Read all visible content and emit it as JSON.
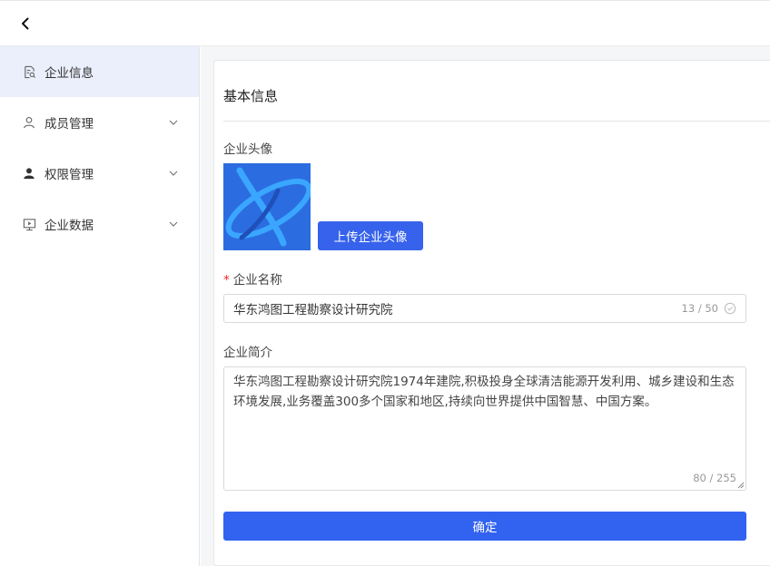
{
  "header": {
    "back_icon": "chevron-left-icon"
  },
  "sidebar": {
    "items": [
      {
        "label": "企业信息",
        "icon": "document-search-icon",
        "active": true,
        "expandable": false
      },
      {
        "label": "成员管理",
        "icon": "user-outline-icon",
        "active": false,
        "expandable": true
      },
      {
        "label": "权限管理",
        "icon": "user-filled-icon",
        "active": false,
        "expandable": true
      },
      {
        "label": "企业数据",
        "icon": "monitor-icon",
        "active": false,
        "expandable": true
      }
    ]
  },
  "form": {
    "section_title": "基本信息",
    "avatar_label": "企业头像",
    "upload_button": "上传企业头像",
    "name_required_mark": "*",
    "name_label": "企业名称",
    "name_value": "华东鸿图工程勘察设计研究院",
    "name_counter": "13 / 50",
    "intro_label": "企业简介",
    "intro_value": "华东鸿图工程勘察设计研究院1974年建院,积极投身全球清洁能源开发利用、城乡建设和生态环境发展,业务覆盖300多个国家和地区,持续向世界提供中国智慧、中国方案。",
    "intro_counter": "80 / 255",
    "confirm_button": "确定"
  },
  "colors": {
    "primary": "#3262f0",
    "avatar_bg": "#2b6de0",
    "avatar_accent": "#3aa6ff",
    "active_nav_bg": "#ebeefb",
    "required": "#f5222d"
  }
}
